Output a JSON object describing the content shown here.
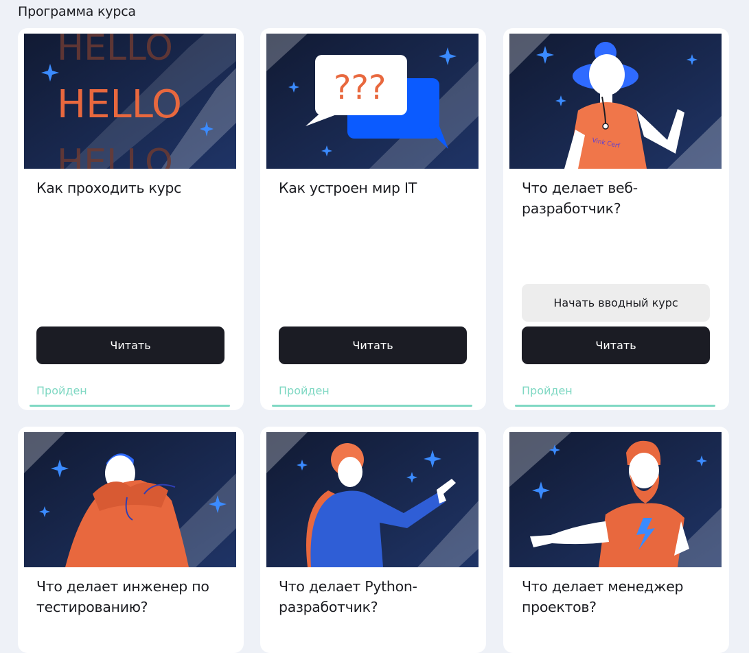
{
  "page": {
    "title": "Программа курса"
  },
  "cards": [
    {
      "title": "Как проходить курс",
      "read_label": "Читать",
      "status": "Пройден",
      "illustration": "hello-text-illustration",
      "art_text": "HELLO"
    },
    {
      "title": "Как устроен мир IT",
      "read_label": "Читать",
      "status": "Пройден",
      "illustration": "speech-bubbles-illustration",
      "art_text": "???"
    },
    {
      "title": "Что делает веб-разработчик?",
      "intro_label": "Начать вводный курс",
      "read_label": "Читать",
      "status": "Пройден",
      "illustration": "woman-waving-illustration",
      "art_text": "Vink Cerf"
    },
    {
      "title": "Что делает инженер по тестированию?",
      "illustration": "man-in-hoodie-illustration"
    },
    {
      "title": "Что делает Python-разработчик?",
      "illustration": "man-pointing-illustration"
    },
    {
      "title": "Что делает менеджер проектов?",
      "illustration": "bearded-man-illustration"
    }
  ],
  "colors": {
    "background": "#eef1f7",
    "card": "#ffffff",
    "dark_button": "#1b1c24",
    "light_button": "#ededed",
    "status_green": "#7fd8c3",
    "illustration_bg": "#16213d",
    "accent_orange": "#e8683e",
    "accent_blue": "#1f6bff"
  },
  "icons": [
    "sparkle-icon"
  ]
}
